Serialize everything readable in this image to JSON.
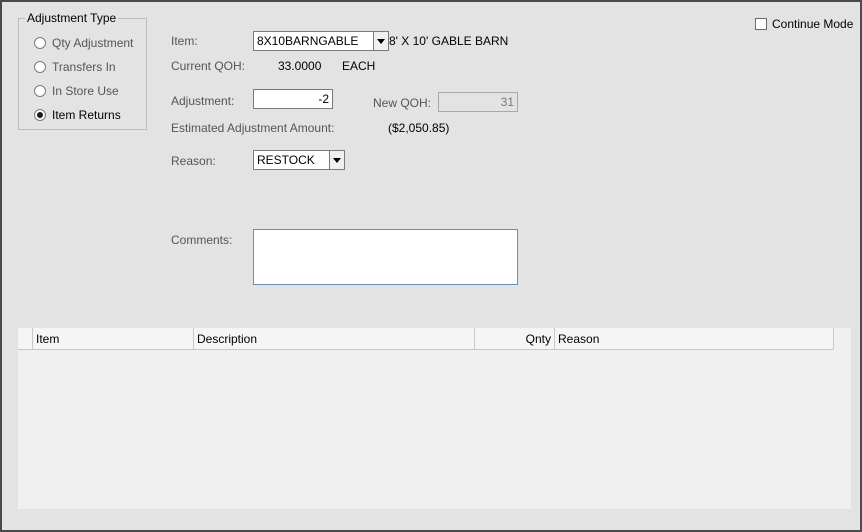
{
  "adjustment_type": {
    "title": "Adjustment Type",
    "options": [
      {
        "label": "Qty Adjustment",
        "checked": false
      },
      {
        "label": "Transfers In",
        "checked": false
      },
      {
        "label": "In Store Use",
        "checked": false
      },
      {
        "label": "Item Returns",
        "checked": true
      }
    ]
  },
  "continue_mode": {
    "label": "Continue Mode",
    "checked": false
  },
  "item": {
    "label": "Item:",
    "value": "8X10BARNGABLE",
    "description": "8' X 10' GABLE BARN"
  },
  "current_qoh": {
    "label": "Current QOH:",
    "value": "33.0000",
    "unit": "EACH"
  },
  "adjustment": {
    "label": "Adjustment:",
    "value": "-2"
  },
  "new_qoh": {
    "label": "New QOH:",
    "value": "31"
  },
  "estimated_amount": {
    "label": "Estimated Adjustment Amount:",
    "value": "($2,050.85)"
  },
  "reason": {
    "label": "Reason:",
    "value": "RESTOCK"
  },
  "comments": {
    "label": "Comments:",
    "value": ""
  },
  "grid": {
    "columns": [
      "Item",
      "Description",
      "Qnty",
      "Reason"
    ],
    "rows": []
  }
}
